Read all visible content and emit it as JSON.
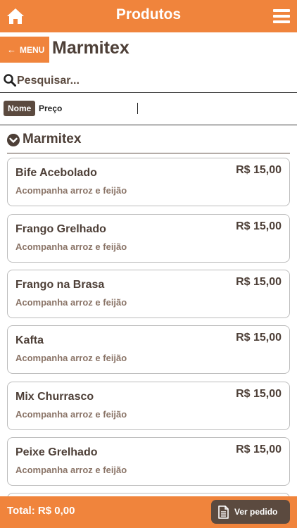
{
  "header": {
    "title": "Produtos"
  },
  "subheader": {
    "menu_label": "MENU",
    "page_title": "Marmitex"
  },
  "search": {
    "placeholder": "Pesquisar..."
  },
  "sort": {
    "name_label": "Nome",
    "price_label": "Preço"
  },
  "section": {
    "title": "Marmitex"
  },
  "products": [
    {
      "name": "Bife Acebolado",
      "price": "R$ 15,00",
      "description": "Acompanha arroz e feijão"
    },
    {
      "name": "Frango Grelhado",
      "price": "R$ 15,00",
      "description": "Acompanha arroz e feijão"
    },
    {
      "name": "Frango na Brasa",
      "price": "R$ 15,00",
      "description": "Acompanha arroz e feijão"
    },
    {
      "name": "Kafta",
      "price": "R$ 15,00",
      "description": "Acompanha arroz e feijão"
    },
    {
      "name": "Mix Churrasco",
      "price": "R$ 15,00",
      "description": "Acompanha arroz e feijão"
    },
    {
      "name": "Peixe Grelhado",
      "price": "R$ 15,00",
      "description": "Acompanha arroz e feijão"
    }
  ],
  "footer": {
    "total": "Total: R$ 0,00",
    "order_button": "Ver pedido"
  },
  "colors": {
    "accent": "#f0843c",
    "dark": "#5b4a3f"
  }
}
